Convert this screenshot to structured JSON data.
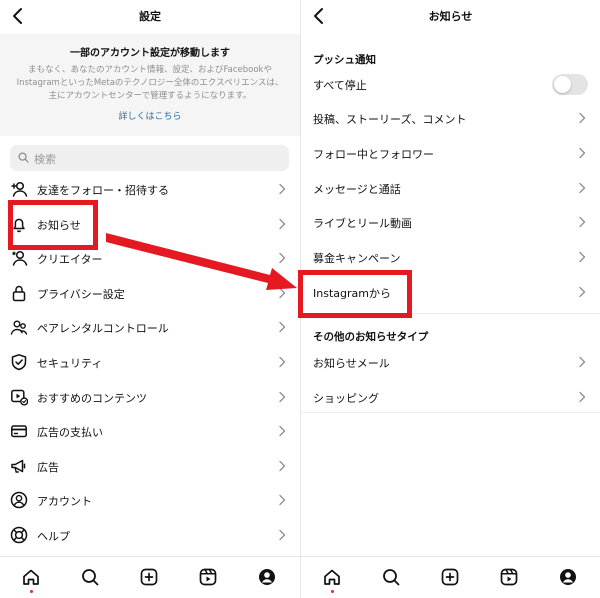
{
  "left": {
    "title": "設定",
    "notice": {
      "title": "一部のアカウント設定が移動します",
      "body": "まもなく、あなたのアカウント情報、設定、およびFacebookやInstagramといったMetaのテクノロジー全体のエクスペリエンスは、主にアカウントセンターで管理するようになります。",
      "link": "詳しくはこちら"
    },
    "search": {
      "placeholder": "検索"
    },
    "items": [
      {
        "label": "友達をフォロー・招待する",
        "icon": "add-person-icon"
      },
      {
        "label": "お知らせ",
        "icon": "bell-icon"
      },
      {
        "label": "クリエイター",
        "icon": "creator-icon"
      },
      {
        "label": "プライバシー設定",
        "icon": "lock-icon"
      },
      {
        "label": "ペアレンタルコントロール",
        "icon": "family-icon"
      },
      {
        "label": "セキュリティ",
        "icon": "shield-icon"
      },
      {
        "label": "おすすめのコンテンツ",
        "icon": "recommended-icon"
      },
      {
        "label": "広告の支払い",
        "icon": "card-icon"
      },
      {
        "label": "広告",
        "icon": "megaphone-icon"
      },
      {
        "label": "アカウント",
        "icon": "account-icon"
      },
      {
        "label": "ヘルプ",
        "icon": "lifebuoy-icon"
      }
    ]
  },
  "right": {
    "title": "お知らせ",
    "push_section": "プッシュ通知",
    "pause_all": {
      "label": "すべて停止",
      "enabled": false
    },
    "push_items": [
      "投稿、ストーリーズ、コメント",
      "フォロー中とフォロワー",
      "メッセージと通話",
      "ライブとリール動画",
      "募金キャンペーン",
      "Instagramから"
    ],
    "other_section": "その他のお知らせタイプ",
    "other_items": [
      "お知らせメール",
      "ショッピング"
    ]
  },
  "tabs": [
    "home-icon",
    "search-icon",
    "create-icon",
    "reels-icon",
    "profile-icon"
  ],
  "colors": {
    "highlight": "#e41921",
    "link": "#2f6fa8",
    "badge": "#e0245e"
  }
}
